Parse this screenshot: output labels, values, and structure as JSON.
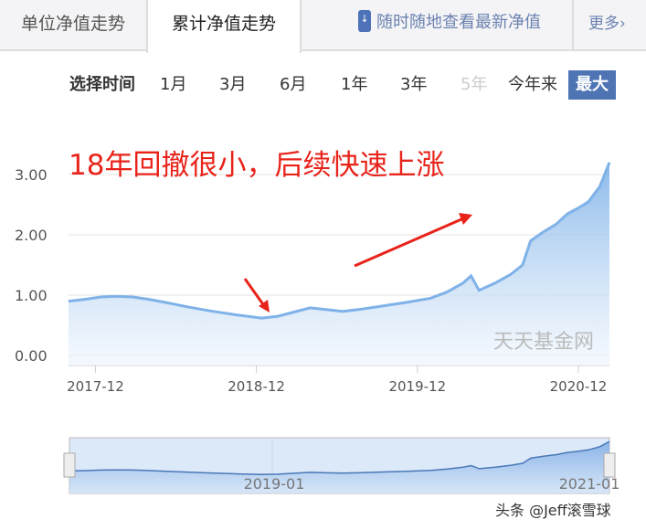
{
  "tabs": [
    {
      "label": "单位净值走势"
    },
    {
      "label": "累计净值走势"
    }
  ],
  "promo": {
    "icon": "phone-download-icon",
    "text": "随时随地查看最新净值"
  },
  "more": "更多›",
  "range": {
    "label": "选择时间",
    "options": [
      "1月",
      "3月",
      "6月",
      "1年",
      "3年",
      "5年",
      "今年来",
      "最大"
    ],
    "selected": "最大",
    "disabled": "5年"
  },
  "annotation": "18年回撤很小，后续快速上涨",
  "watermark": "天天基金网",
  "credit": "头条 @Jeff滚雪球",
  "colors": {
    "line": "#7fb2e8",
    "accent": "#4f74b4",
    "annotation": "#e8231a"
  },
  "chart_data": {
    "type": "area",
    "title": "累计净值走势",
    "xlabel": "",
    "ylabel": "",
    "ylim": [
      0,
      3.2
    ],
    "yticks": [
      "0.00",
      "1.00",
      "2.00",
      "3.00"
    ],
    "xticks": [
      {
        "label": "2017-12",
        "t": 2017.917
      },
      {
        "label": "2018-12",
        "t": 2018.917
      },
      {
        "label": "2019-12",
        "t": 2019.917
      },
      {
        "label": "2020-12",
        "t": 2020.917
      }
    ],
    "xlim": [
      2017.75,
      2021.11
    ],
    "grid": true,
    "series": [
      {
        "name": "累计净值",
        "points": [
          [
            2017.75,
            0.9
          ],
          [
            2017.85,
            0.93
          ],
          [
            2017.95,
            0.97
          ],
          [
            2018.05,
            0.98
          ],
          [
            2018.15,
            0.97
          ],
          [
            2018.25,
            0.93
          ],
          [
            2018.35,
            0.88
          ],
          [
            2018.5,
            0.8
          ],
          [
            2018.65,
            0.73
          ],
          [
            2018.8,
            0.67
          ],
          [
            2018.95,
            0.62
          ],
          [
            2019.05,
            0.65
          ],
          [
            2019.15,
            0.72
          ],
          [
            2019.25,
            0.79
          ],
          [
            2019.35,
            0.76
          ],
          [
            2019.45,
            0.73
          ],
          [
            2019.55,
            0.76
          ],
          [
            2019.7,
            0.82
          ],
          [
            2019.85,
            0.88
          ],
          [
            2020.0,
            0.95
          ],
          [
            2020.1,
            1.05
          ],
          [
            2020.2,
            1.2
          ],
          [
            2020.25,
            1.32
          ],
          [
            2020.3,
            1.08
          ],
          [
            2020.4,
            1.2
          ],
          [
            2020.5,
            1.35
          ],
          [
            2020.57,
            1.5
          ],
          [
            2020.62,
            1.9
          ],
          [
            2020.7,
            2.05
          ],
          [
            2020.78,
            2.18
          ],
          [
            2020.85,
            2.35
          ],
          [
            2020.92,
            2.45
          ],
          [
            2020.98,
            2.55
          ],
          [
            2021.05,
            2.8
          ],
          [
            2021.11,
            3.2
          ]
        ]
      }
    ],
    "navigator": {
      "labels": [
        "2019-01",
        "2021-01"
      ]
    }
  }
}
